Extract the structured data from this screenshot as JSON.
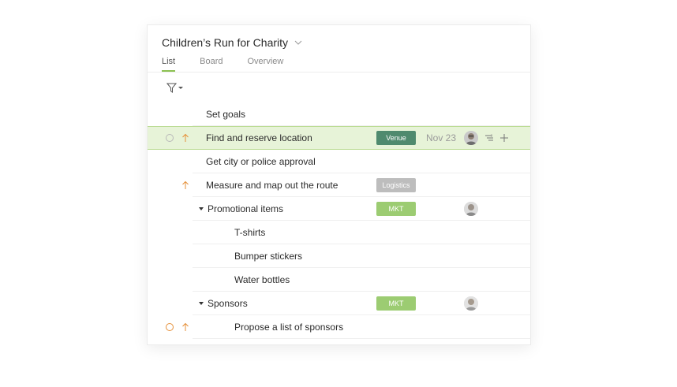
{
  "project": {
    "title": "Children’s Run for Charity"
  },
  "tabs": [
    {
      "label": "List",
      "active": true
    },
    {
      "label": "Board",
      "active": false
    },
    {
      "label": "Overview",
      "active": false
    }
  ],
  "colors": {
    "accent": "#8cc152",
    "highlight_bg": "#e7f3d8",
    "tag_venue": "#4f8a6e",
    "tag_logistics": "#bdbdbd",
    "tag_mkt": "#9ccc72",
    "priority_arrow": "#e6913b"
  },
  "rows": [
    {
      "label": "Set goals"
    },
    {
      "label": "Find and reserve location",
      "tag": "Venue",
      "due": "Nov 23"
    },
    {
      "label": "Get city or police approval"
    },
    {
      "label": "Measure and map out the route",
      "tag": "Logistics"
    },
    {
      "label": "Promotional items",
      "tag": "MKT"
    },
    {
      "label": "T-shirts"
    },
    {
      "label": "Bumper stickers"
    },
    {
      "label": "Water bottles"
    },
    {
      "label": "Sponsors",
      "tag": "MKT"
    },
    {
      "label": "Propose a list of sponsors"
    }
  ]
}
